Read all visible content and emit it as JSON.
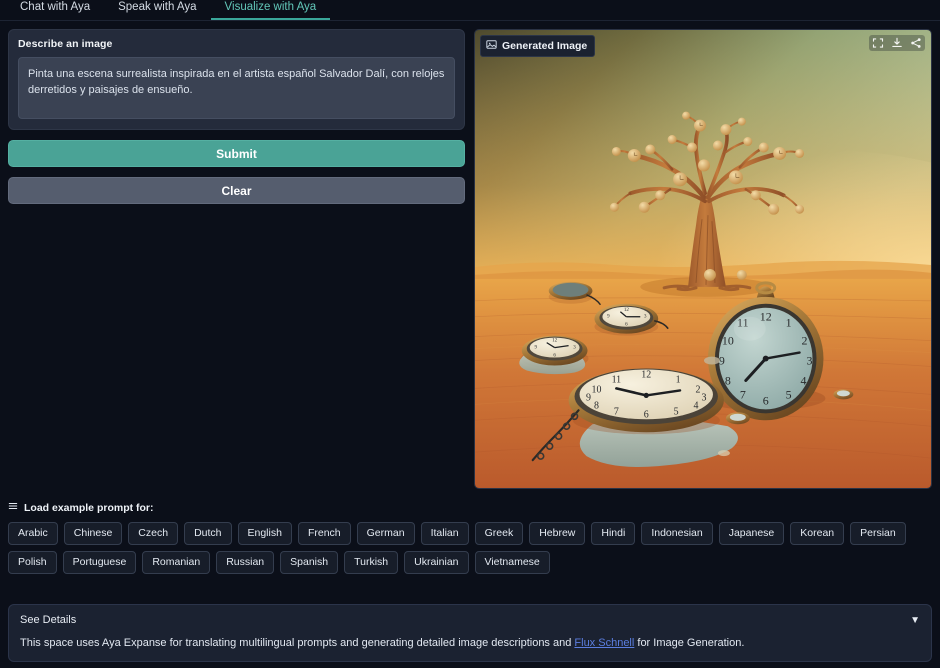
{
  "tabs": [
    {
      "label": "Chat with Aya",
      "active": false
    },
    {
      "label": "Speak with Aya",
      "active": false
    },
    {
      "label": "Visualize with Aya",
      "active": true
    }
  ],
  "prompt_panel": {
    "label": "Describe an image",
    "value": "Pinta una escena surrealista inspirada en el artista español Salvador Dalí, con relojes derretidos y paisajes de ensueño.",
    "placeholder": "Describe an image"
  },
  "actions": {
    "submit_label": "Submit",
    "clear_label": "Clear",
    "submit_color": "#4aa396",
    "clear_color": "#555d6e"
  },
  "image_panel": {
    "badge_label": "Generated Image",
    "badge_icon": "image-icon",
    "tools": [
      {
        "name": "fullscreen-icon",
        "title": "Fullscreen"
      },
      {
        "name": "download-icon",
        "title": "Download"
      },
      {
        "name": "share-icon",
        "title": "Share"
      }
    ],
    "artwork": {
      "description": "Surrealist desert scene with melting pocket watches and a tree bearing clock-faces",
      "sky_left": "#5d5233",
      "sky_right": "#a9bd95",
      "horizon_glow": "#e9a94e",
      "sand_near": "#c2612f",
      "sand_far": "#e2953f",
      "clock_dial": "#9fb7b3",
      "clock_dial_warm": "#efe6d2",
      "bezel": "#b4843f"
    }
  },
  "examples": {
    "header": "Load example prompt for:",
    "header_icon": "list-icon",
    "languages": [
      "Arabic",
      "Chinese",
      "Czech",
      "Dutch",
      "English",
      "French",
      "German",
      "Italian",
      "Greek",
      "Hebrew",
      "Hindi",
      "Indonesian",
      "Japanese",
      "Korean",
      "Persian",
      "Polish",
      "Portuguese",
      "Romanian",
      "Russian",
      "Spanish",
      "Turkish",
      "Ukrainian",
      "Vietnamese"
    ]
  },
  "details": {
    "title": "See Details",
    "caret": "▼",
    "body_before": "This space uses Aya Expanse for translating multilingual prompts and generating detailed image descriptions and ",
    "link_text": "Flux Schnell",
    "body_after": " for Image Generation.",
    "link_color": "#5b7ee0"
  }
}
